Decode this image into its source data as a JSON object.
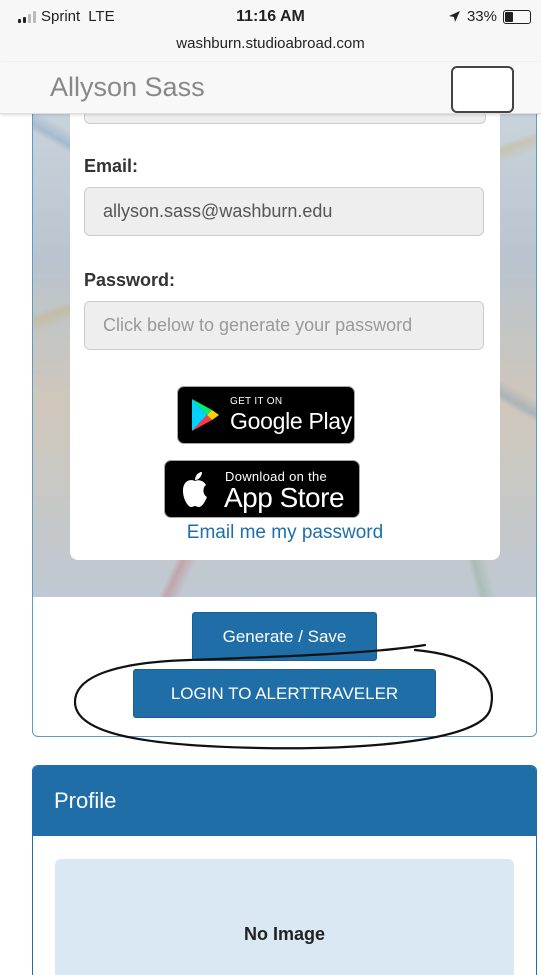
{
  "status_bar": {
    "carrier": "Sprint",
    "network": "LTE",
    "time": "11:16 AM",
    "url": "washburn.studioabroad.com",
    "location_icon": "location-arrow-icon",
    "battery": "33%"
  },
  "navbar": {
    "brand": "Allyson Sass",
    "menu_icon": "hamburger-menu-icon"
  },
  "form": {
    "email_label": "Email:",
    "email_value": "allyson.sass@washburn.edu",
    "password_label": "Password:",
    "password_placeholder": "Click below to generate your password",
    "google_play": {
      "small": "GET IT ON",
      "big": "Google Play"
    },
    "app_store": {
      "small": "Download on the",
      "big": "App Store"
    },
    "email_password_link": "Email me my password"
  },
  "buttons": {
    "generate_save": "Generate / Save",
    "login_alerttraveler": "LOGIN TO ALERTTRAVELER"
  },
  "profile": {
    "title": "Profile",
    "image_placeholder": "No Image"
  },
  "colors": {
    "primary": "#1f6ea8",
    "profile_image_bg": "#d9e8f3"
  }
}
